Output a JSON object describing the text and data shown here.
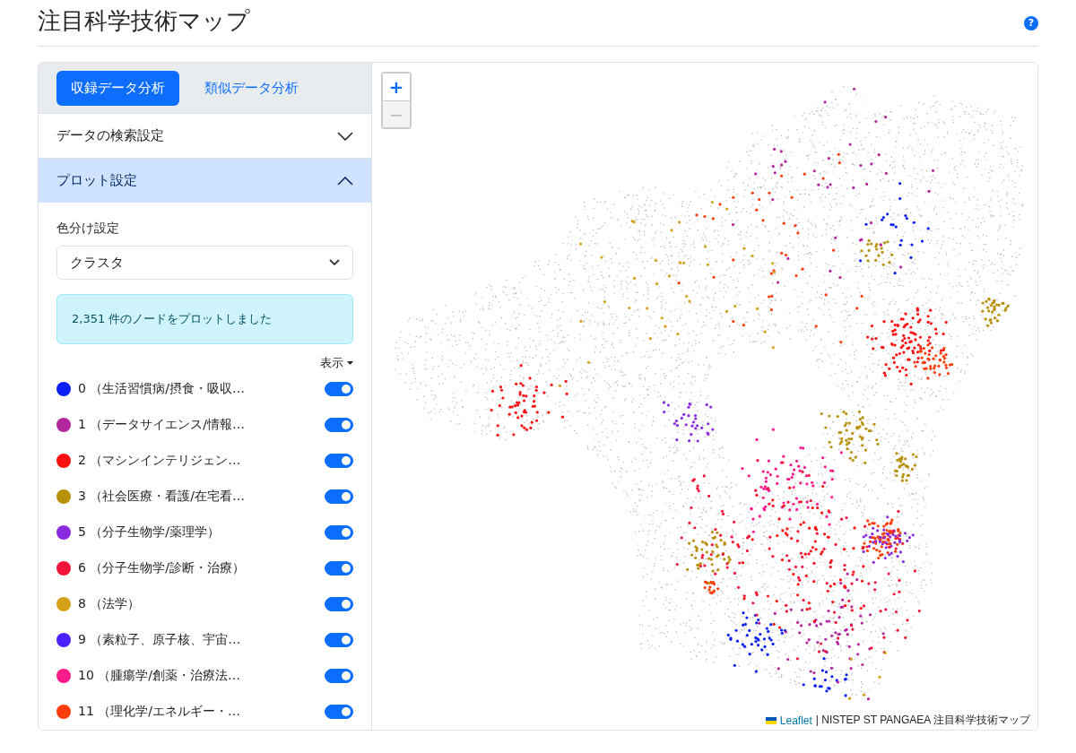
{
  "page": {
    "title": "注目科学技術マップ",
    "help": "?"
  },
  "tabs": [
    {
      "label": "収録データ分析",
      "selected": true
    },
    {
      "label": "類似データ分析",
      "selected": false
    }
  ],
  "sections": [
    {
      "title": "データの検索設定",
      "expanded": false
    },
    {
      "title": "プロット設定",
      "expanded": true
    }
  ],
  "plot_settings": {
    "color_label": "色分け設定",
    "color_select": {
      "value": "クラスタ"
    },
    "alert": "2,351 件のノードをプロットしました",
    "display_menu": "表示"
  },
  "clusters": [
    {
      "label": "0 （生活習慣病/摂食・吸収…",
      "color": "#0a1ff5",
      "on": true
    },
    {
      "label": "1 （データサイエンス/情報…",
      "color": "#b5279f",
      "on": true
    },
    {
      "label": "2 （マシンインテリジェン…",
      "color": "#ff1010",
      "on": true
    },
    {
      "label": "3 （社会医療・看護/在宅看…",
      "color": "#b8900a",
      "on": true
    },
    {
      "label": "5 （分子生物学/薬理学）",
      "color": "#8a2be2",
      "on": true
    },
    {
      "label": "6 （分子生物学/診断・治療）",
      "color": "#f5153a",
      "on": true
    },
    {
      "label": "8 （法学）",
      "color": "#d4a017",
      "on": true
    },
    {
      "label": "9 （素粒子、原子核、宇宙…",
      "color": "#4b22ff",
      "on": true
    },
    {
      "label": "10 （腫瘍学/創薬・治療法…",
      "color": "#ff1a8c",
      "on": true
    },
    {
      "label": "11 （理化学/エネルギー・…",
      "color": "#ff3d0a",
      "on": true
    }
  ],
  "map": {
    "zoom_in": "+",
    "zoom_out": "−",
    "zoom_out_disabled": true,
    "attribution_link": "Leaflet",
    "attribution_text": "| NISTEP ST PANGAEA 注目科学技術マップ"
  }
}
